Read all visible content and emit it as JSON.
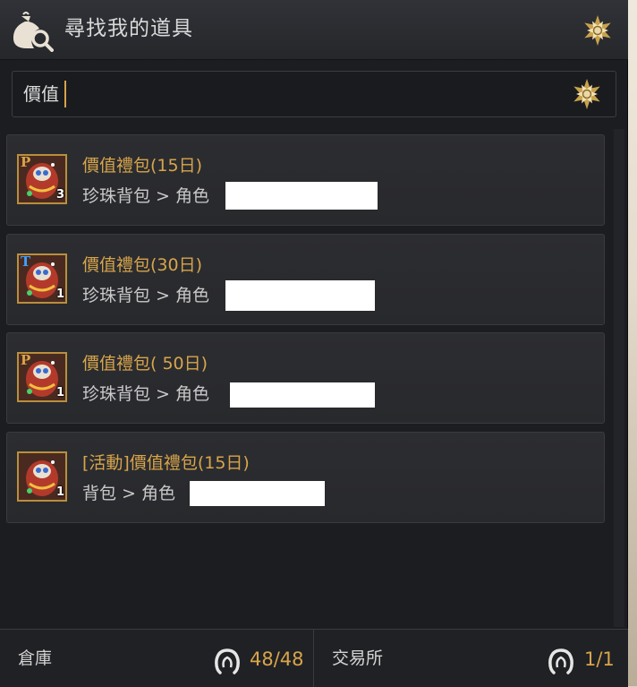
{
  "header": {
    "title": "尋找我的道具",
    "icon": "search-bag-icon",
    "settings_icon": "flower-emblem-icon"
  },
  "search": {
    "value": "價值",
    "placeholder": "",
    "icon": "flower-emblem-icon"
  },
  "results": [
    {
      "grade": "P",
      "count": "3",
      "name": "價值禮包(15日)",
      "location": "珍珠背包 > 角色"
    },
    {
      "grade": "T",
      "count": "1",
      "name": "價值禮包(30日)",
      "location": "珍珠背包 > 角色"
    },
    {
      "grade": "P",
      "count": "1",
      "name": "價值禮包( 50日)",
      "location": "珍珠背包 > 角色"
    },
    {
      "grade": "",
      "count": "1",
      "name": "[活動]價值禮包(15日)",
      "location": "背包 > 角色"
    }
  ],
  "footer": {
    "warehouse": {
      "label": "倉庫",
      "count": "48/48"
    },
    "market": {
      "label": "交易所",
      "count": "1/1"
    }
  },
  "colors": {
    "accent_gold": "#d8a54b",
    "grade_p": "#d8a54b",
    "grade_t": "#3fa0ff",
    "panel_bg": "#1c1d20"
  }
}
